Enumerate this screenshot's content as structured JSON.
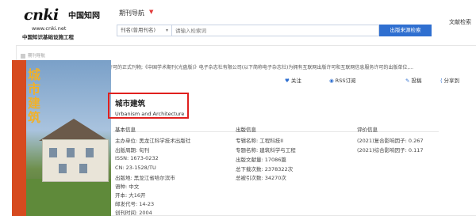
{
  "header": {
    "logo": {
      "brand": "cnki",
      "cn": "中国知网",
      "url": "www.cnki.net",
      "subtitle": "中国知识基础设施工程"
    },
    "nav_title": "期刊导航",
    "search": {
      "scope": "刊名(曾用刊名)",
      "placeholder": "请输入检索词",
      "button": "出版来源检索"
    },
    "top_right": "文献检索"
  },
  "breadcrumb": "期刊导航",
  "top_text": "许可的正式刊物;《中国学术期刊(光盘版)》电子杂志社有限公司(以下简称电子杂志社)为拥有互联网出版许可和互联网信息服务许可的出版单位,...",
  "journal": {
    "title": "城市建筑",
    "title_en": "Urbanism and Architecture",
    "cover_title": "城市建筑"
  },
  "actions": [
    {
      "icon": "heart-icon",
      "glyph": "♥",
      "label": "关注"
    },
    {
      "icon": "rss-icon",
      "glyph": "◉",
      "label": "RSS订阅"
    },
    {
      "icon": "submit-icon",
      "glyph": "✎",
      "label": "投稿"
    },
    {
      "icon": "share-icon",
      "glyph": "⟨",
      "label": "分享到"
    }
  ],
  "basic_info": {
    "heading": "基本信息",
    "rows": [
      "主办单位: 黑龙江科学技术出版社",
      "出版周期: 旬刊",
      "ISSN: 1673-0232",
      "CN: 23-1528/TU",
      "出版地: 黑龙江省哈尔滨市",
      "语种: 中文",
      "开本: 大16开",
      "邮发代号: 14-23",
      "创刊时间: 2004"
    ]
  },
  "publish_info": {
    "heading": "出版信息",
    "rows": [
      "专辑名称: 工程科技II",
      "专题名称: 建筑科学与工程",
      "出版文献量: 17086篇",
      "总下载次数: 2378322次",
      "总被引次数: 34270次"
    ]
  },
  "eval_info": {
    "heading": "评价信息",
    "rows": [
      "(2021)复合影响因子: 0.267",
      "(2021)综合影响因子: 0.117"
    ]
  }
}
